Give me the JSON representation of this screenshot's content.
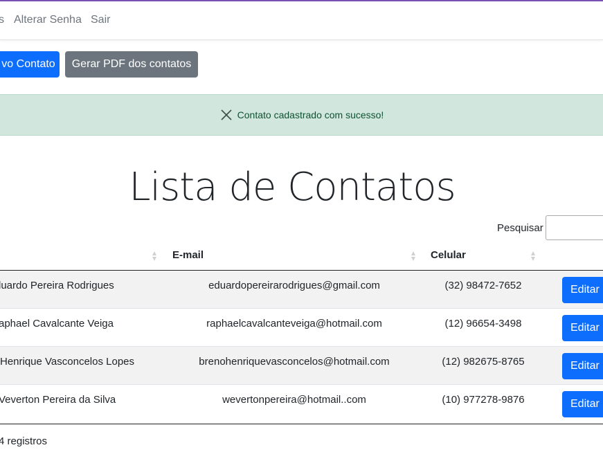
{
  "navbar": {
    "items": [
      {
        "label": "s"
      },
      {
        "label": "Alterar Senha"
      },
      {
        "label": "Sair"
      }
    ]
  },
  "toolbar": {
    "new_contact_label": "vo Contato",
    "pdf_label": "Gerar PDF dos contatos"
  },
  "alert": {
    "message": "Contato cadastrado com sucesso!",
    "close_icon": "close-icon",
    "color": "#d1e7dd"
  },
  "page": {
    "title": "Lista de Contatos"
  },
  "search": {
    "label": "Pesquisar",
    "value": ""
  },
  "table": {
    "columns": [
      "E-mail",
      "Celular"
    ],
    "rows": [
      {
        "name": "luardo Pereira Rodrigues",
        "email": "eduardopereirarodrigues@gmail.com",
        "phone": "(32) 98472-7652",
        "action": "Editar"
      },
      {
        "name": "aphael Cavalcante Veiga",
        "email": "raphaelcavalcanteveiga@hotmail.com",
        "phone": "(12) 96654-3498",
        "action": "Editar"
      },
      {
        "name": "Henrique Vasconcelos Lopes",
        "email": "brenohenriquevasconcelos@hotmail.com",
        "phone": "(12) 982675-8765",
        "action": "Editar"
      },
      {
        "name": "Veverton Pereira da Silva",
        "email": "wevertonpereira@hotmail..com",
        "phone": "(10) 977278-9876",
        "action": "Editar"
      }
    ]
  },
  "footer": {
    "info": "4 registros"
  },
  "colors": {
    "primary": "#0d6efd",
    "secondary": "#6c757d",
    "success_bg": "#d1e7dd",
    "success_text": "#0f5132"
  }
}
